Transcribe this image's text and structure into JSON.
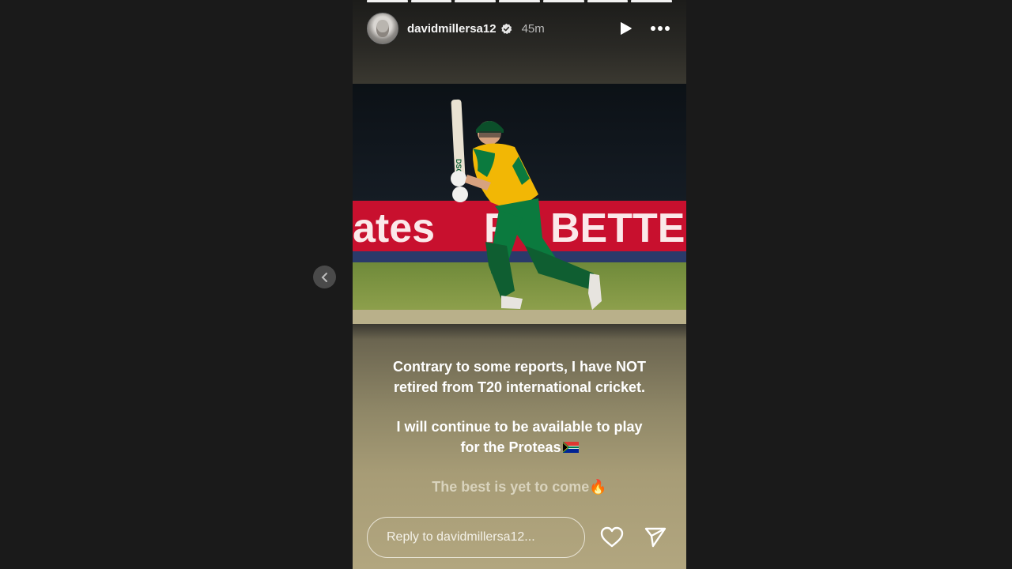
{
  "story": {
    "username": "davidmillersa12",
    "time_ago": "45m",
    "progress_segments": 7,
    "caption": {
      "line1": "Contrary to some reports, I have NOT",
      "line2": "retired from T20 international cricket.",
      "line3": "I will continue to be available to play",
      "line4": "for the Proteas",
      "line5": "The best is yet to come",
      "fire_emoji": "🔥"
    },
    "photo": {
      "banner_left": "ates",
      "banner_right": "BETTER",
      "banner_mid": "F"
    }
  },
  "reply": {
    "placeholder": "Reply to davidmillersa12..."
  },
  "colors": {
    "background": "#1a1a1a",
    "banner_red": "#c8102e",
    "kit_green": "#0b7a3e",
    "kit_yellow": "#f2b705"
  },
  "icons": {
    "verified": "verified-badge-icon",
    "play": "play-icon",
    "more": "more-options-icon",
    "like": "heart-icon",
    "share": "send-icon",
    "prev": "chevron-left-icon"
  }
}
